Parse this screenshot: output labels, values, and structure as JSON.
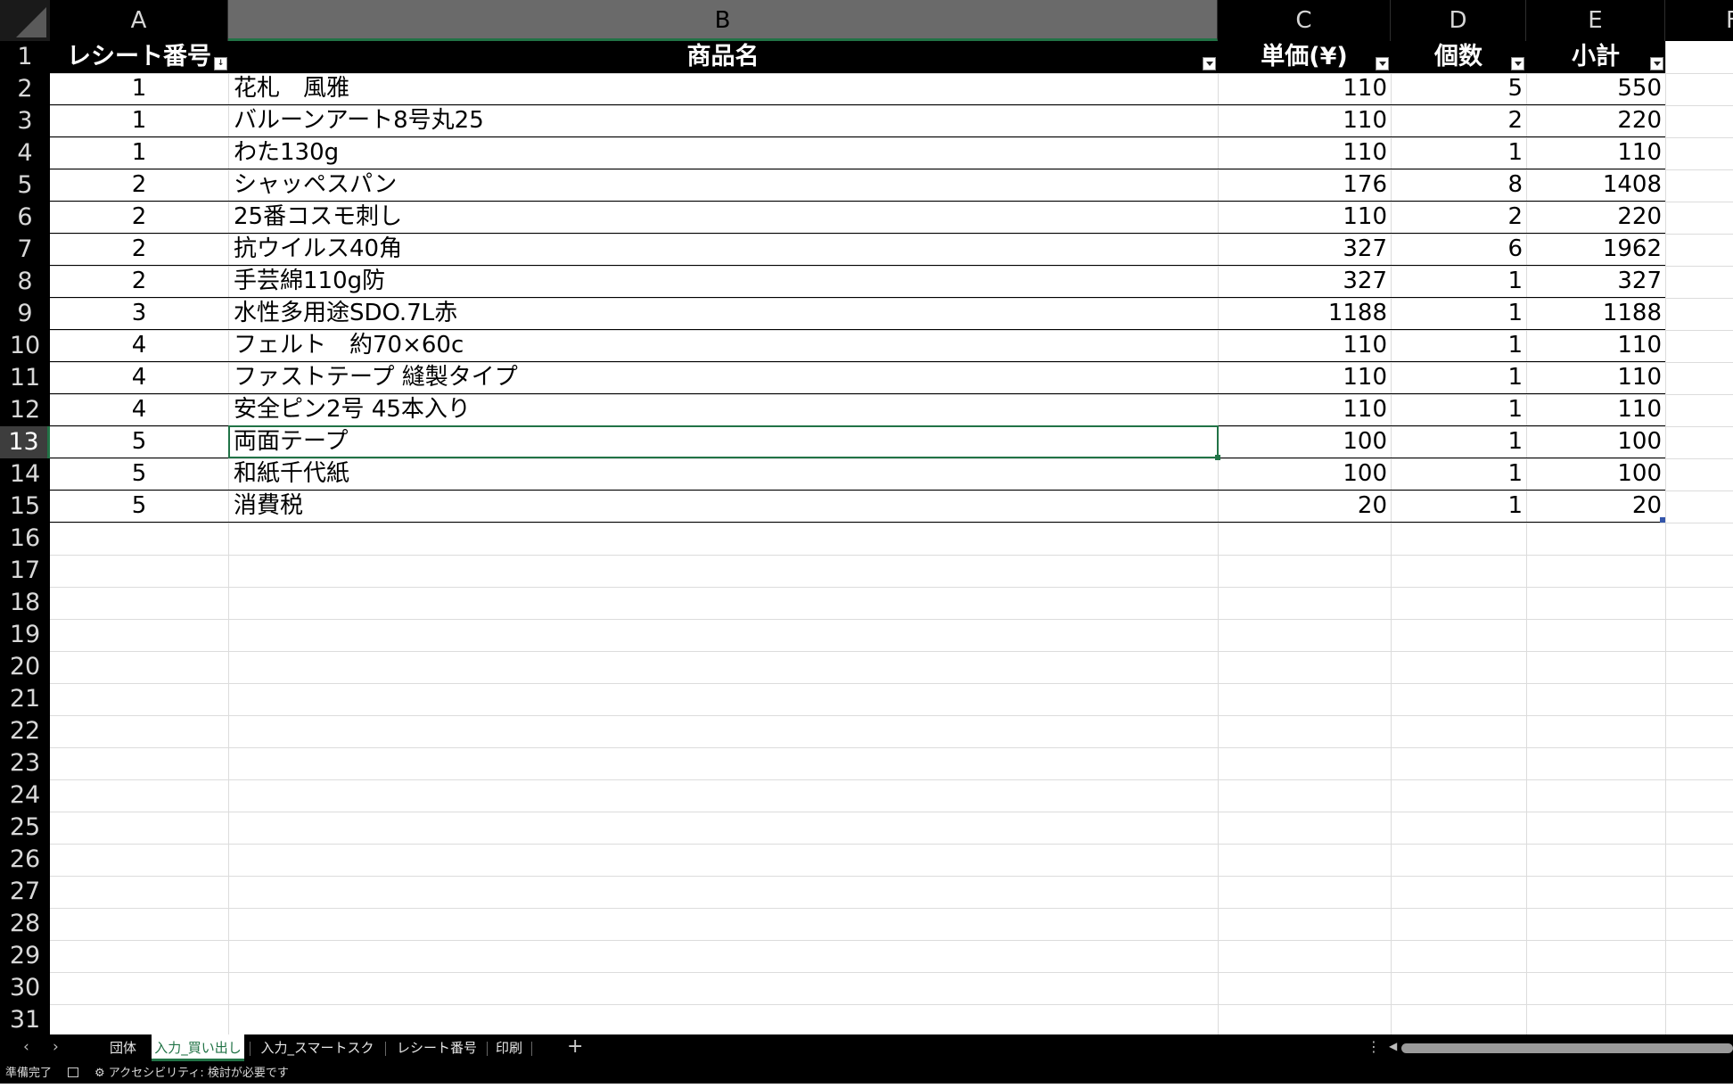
{
  "columns": [
    "A",
    "B",
    "C",
    "D",
    "E",
    "F"
  ],
  "row_numbers": [
    "1",
    "2",
    "3",
    "4",
    "5",
    "6",
    "7",
    "8",
    "9",
    "10",
    "11",
    "12",
    "13",
    "14",
    "15",
    "16",
    "17",
    "18",
    "19",
    "20",
    "21",
    "22",
    "23",
    "24",
    "25",
    "26",
    "27",
    "28",
    "29",
    "30",
    "31"
  ],
  "table": {
    "headers": [
      "レシート番号",
      "商品名",
      "単価(¥)",
      "個数",
      "小計"
    ],
    "rows": [
      [
        "1",
        "花札　風雅",
        "110",
        "5",
        "550"
      ],
      [
        "1",
        "バルーンアート8号丸25",
        "110",
        "2",
        "220"
      ],
      [
        "1",
        "わた130g",
        "110",
        "1",
        "110"
      ],
      [
        "2",
        "シャッペスパン",
        "176",
        "8",
        "1408"
      ],
      [
        "2",
        "25番コスモ刺し",
        "110",
        "2",
        "220"
      ],
      [
        "2",
        "抗ウイルス40角",
        "327",
        "6",
        "1962"
      ],
      [
        "2",
        "手芸綿110g防",
        "327",
        "1",
        "327"
      ],
      [
        "3",
        "水性多用途SDO.7L赤",
        "1188",
        "1",
        "1188"
      ],
      [
        "4",
        "フェルト　約70×60c",
        "110",
        "1",
        "110"
      ],
      [
        "4",
        "ファストテープ 縫製タイプ",
        "110",
        "1",
        "110"
      ],
      [
        "4",
        "安全ピン2号 45本入り",
        "110",
        "1",
        "110"
      ],
      [
        "5",
        "両面テープ",
        "100",
        "1",
        "100"
      ],
      [
        "5",
        "和紙千代紙",
        "100",
        "1",
        "100"
      ],
      [
        "5",
        "消費税",
        "20",
        "1",
        "20"
      ]
    ]
  },
  "selection": {
    "cell": "B13",
    "row": "13",
    "column": "B"
  },
  "sheet_tabs": [
    "団体",
    "入力_買い出し",
    "入力_スマートスクール",
    "レシート番号別",
    "印刷"
  ],
  "active_tab": "入力_買い出し",
  "nav": {
    "prev": "‹",
    "next": "›",
    "add": "+",
    "more": "⋮"
  },
  "status": {
    "ready": "準備完了",
    "accessibility": "アクセシビリティ: 検討が必要です"
  },
  "colors": {
    "accent": "#217346",
    "header_bg": "#000000",
    "grid": "#dcdcdc"
  }
}
